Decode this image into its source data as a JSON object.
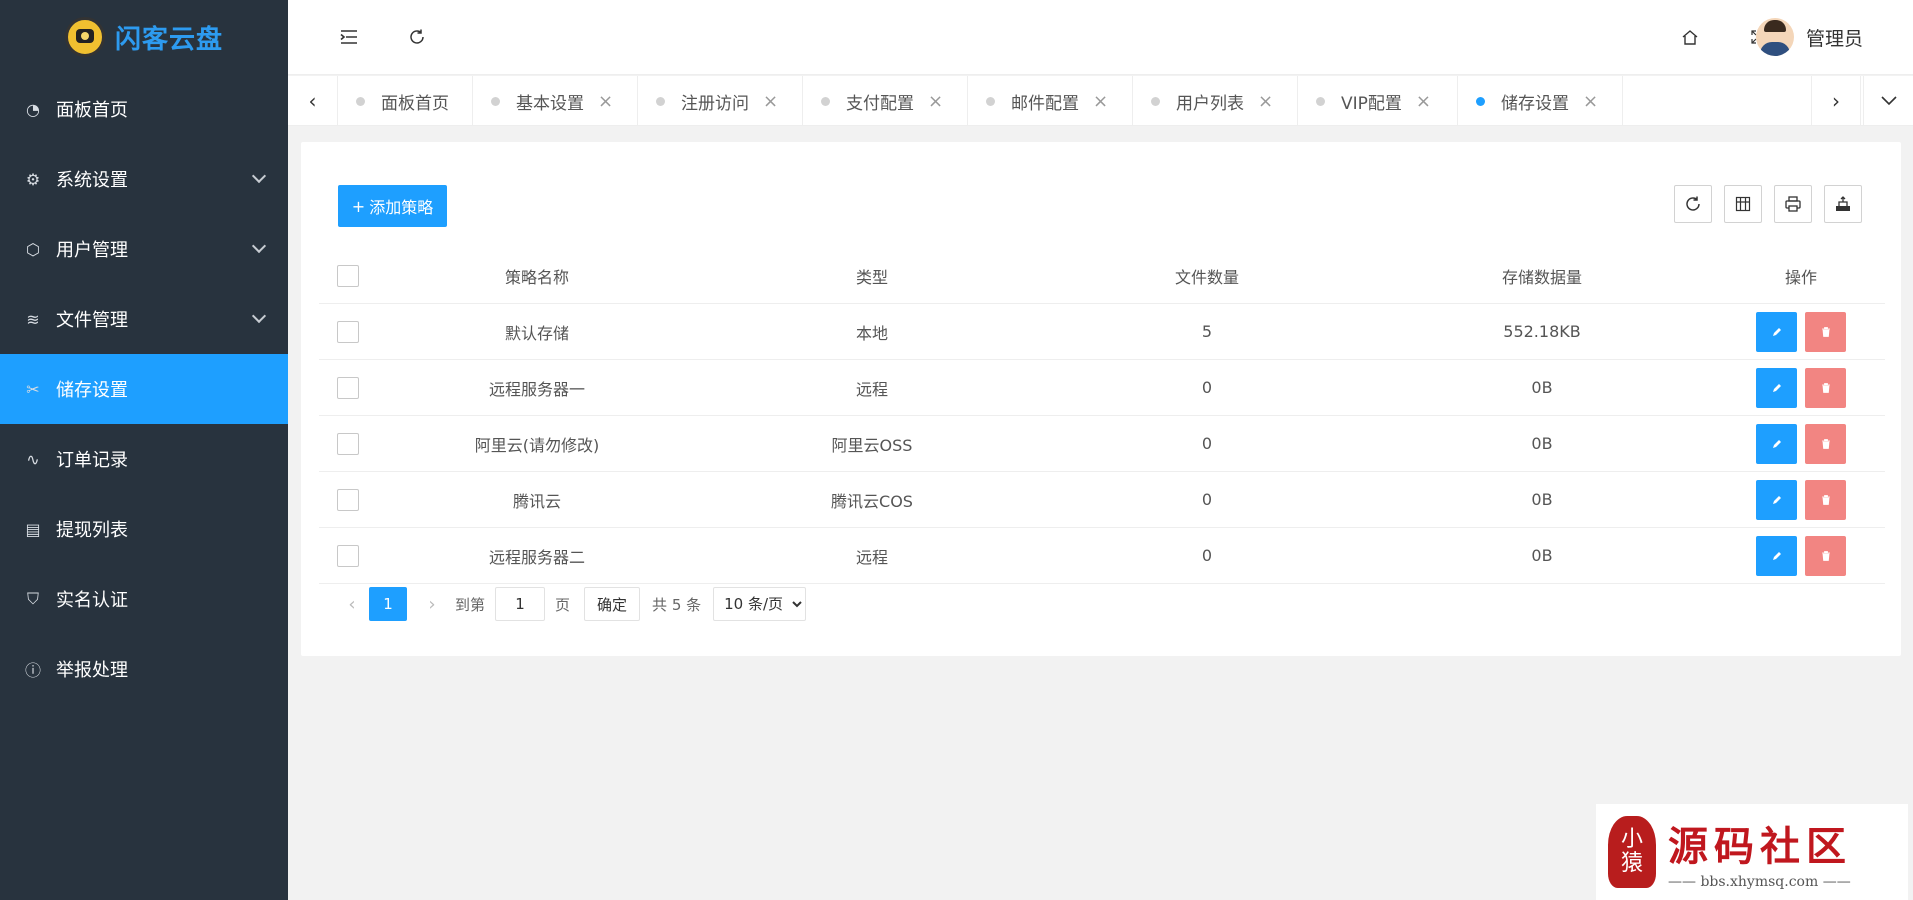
{
  "app": {
    "title": "闪客云盘"
  },
  "sidebar": {
    "items": [
      {
        "label": "面板首页",
        "icon": "dashboard-icon"
      },
      {
        "label": "系统设置",
        "icon": "gear-icon",
        "expandable": true
      },
      {
        "label": "用户管理",
        "icon": "cube-icon",
        "expandable": true
      },
      {
        "label": "文件管理",
        "icon": "layers-icon",
        "expandable": true
      },
      {
        "label": "储存设置",
        "icon": "tools-icon",
        "active": true
      },
      {
        "label": "订单记录",
        "icon": "pulse-icon"
      },
      {
        "label": "提现列表",
        "icon": "clipboard-icon"
      },
      {
        "label": "实名认证",
        "icon": "shield-check-icon"
      },
      {
        "label": "举报处理",
        "icon": "info-icon"
      }
    ]
  },
  "header": {
    "user_name": "管理员"
  },
  "tabs": [
    {
      "label": "面板首页",
      "closable": false
    },
    {
      "label": "基本设置",
      "closable": true
    },
    {
      "label": "注册访问",
      "closable": true
    },
    {
      "label": "支付配置",
      "closable": true
    },
    {
      "label": "邮件配置",
      "closable": true
    },
    {
      "label": "用户列表",
      "closable": true
    },
    {
      "label": "VIP配置",
      "closable": true
    },
    {
      "label": "储存设置",
      "closable": true,
      "active": true
    }
  ],
  "toolbar": {
    "add_label": "添加策略"
  },
  "table": {
    "headers": [
      "策略名称",
      "类型",
      "文件数量",
      "存储数据量",
      "操作"
    ],
    "rows": [
      [
        "默认存储",
        "本地",
        "5",
        "552.18KB"
      ],
      [
        "远程服务器一",
        "远程",
        "0",
        "0B"
      ],
      [
        "阿里云(请勿修改)",
        "阿里云OSS",
        "0",
        "0B"
      ],
      [
        "腾讯云",
        "腾讯云COS",
        "0",
        "0B"
      ],
      [
        "远程服务器二",
        "远程",
        "0",
        "0B"
      ]
    ]
  },
  "pager": {
    "current": "1",
    "goto_label": "到第",
    "goto_value": "1",
    "page_unit": "页",
    "confirm_label": "确定",
    "total_label": "共 5 条",
    "page_size": "10 条/页"
  },
  "watermark": {
    "title": "源码社区",
    "subtitle": "—— bbs.xhymsq.com ——",
    "seal_line1": "小",
    "seal_line2": "猿"
  },
  "colors": {
    "sidebar": "#28333e",
    "accent": "#1e9fff",
    "danger": "#f0706d"
  }
}
